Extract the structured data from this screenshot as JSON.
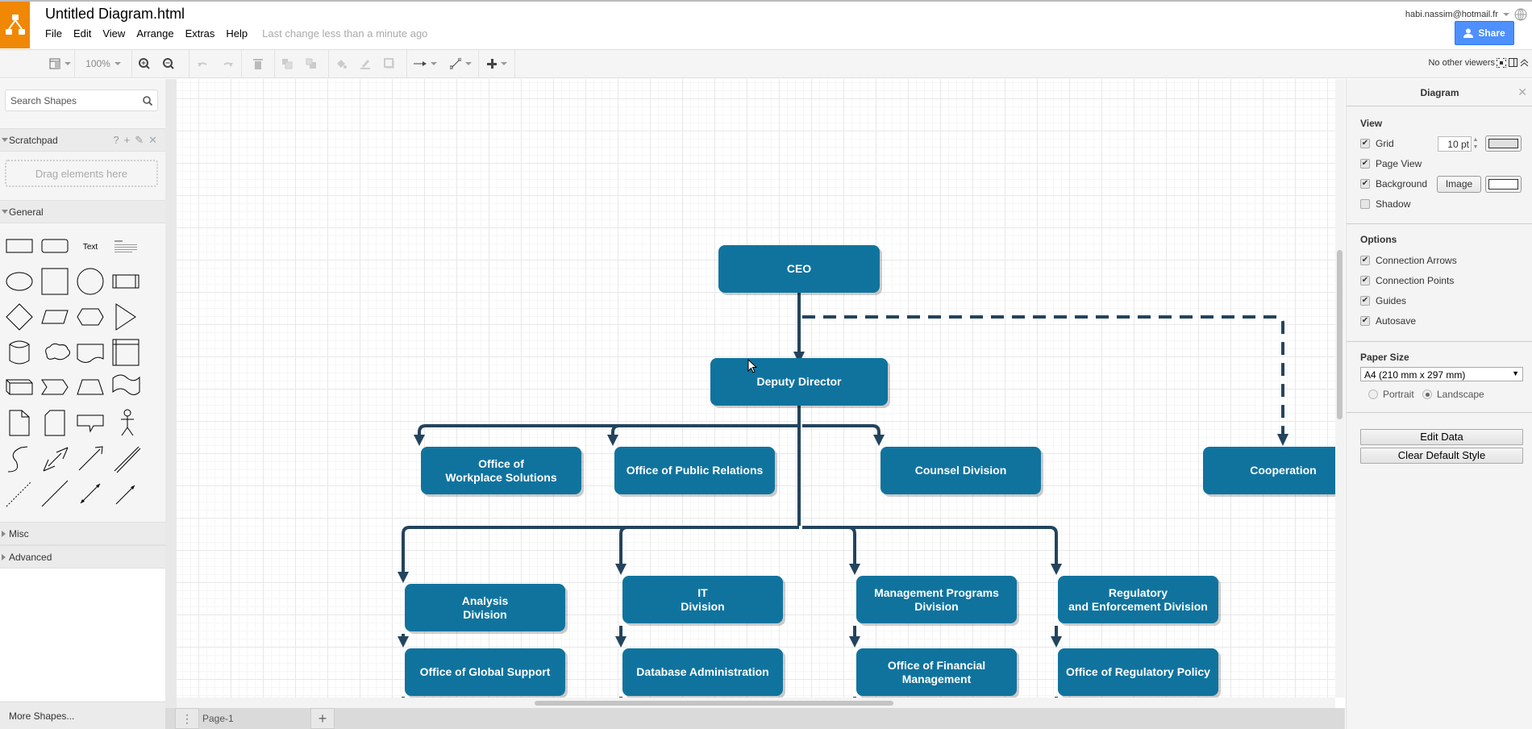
{
  "app": {
    "title": "Untitled Diagram.html",
    "menu": [
      "File",
      "Edit",
      "View",
      "Arrange",
      "Extras",
      "Help"
    ],
    "last_change": "Last change less than a minute ago",
    "user": "habi.nassim@hotmail.fr",
    "share_label": "Share",
    "viewers": "No other viewers"
  },
  "toolbar": {
    "zoom": "100%"
  },
  "sidebar": {
    "search_placeholder": "Search Shapes",
    "scratchpad": "Scratchpad",
    "scratchpad_actions": [
      "?",
      "+",
      "✎",
      "✕"
    ],
    "drop_hint": "Drag elements here",
    "general": "General",
    "text_shape": "Text",
    "misc": "Misc",
    "advanced": "Advanced",
    "more_shapes": "More Shapes..."
  },
  "pages": {
    "current": "Page-1"
  },
  "panel": {
    "title": "Diagram",
    "view_heading": "View",
    "grid": {
      "label": "Grid",
      "checked": true,
      "size": "10 pt",
      "color": "#e0e0e0"
    },
    "page_view": {
      "label": "Page View",
      "checked": true
    },
    "background": {
      "label": "Background",
      "checked": true,
      "image_button": "Image",
      "color": "#ffffff"
    },
    "shadow": {
      "label": "Shadow",
      "checked": false
    },
    "options_heading": "Options",
    "options": [
      {
        "label": "Connection Arrows",
        "checked": true
      },
      {
        "label": "Connection Points",
        "checked": true
      },
      {
        "label": "Guides",
        "checked": true
      },
      {
        "label": "Autosave",
        "checked": true
      }
    ],
    "paper_heading": "Paper Size",
    "paper_size": "A4 (210 mm x 297 mm)",
    "orientation": {
      "portrait": "Portrait",
      "landscape": "Landscape",
      "selected": "landscape"
    },
    "edit_data": "Edit Data",
    "clear_style": "Clear Default Style"
  },
  "diagram": {
    "node_color": "#10739e",
    "edge_color": "#23445d",
    "nodes": {
      "ceo": "CEO",
      "deputy": "Deputy Director",
      "workplace": "Office of\nWorkplace Solutions",
      "public_relations": "Office of Public Relations",
      "counsel": "Counsel Division",
      "cooperation": "Cooperation",
      "analysis": "Analysis\nDivision",
      "it": "IT\nDivision",
      "management": "Management Programs\nDivision",
      "regulatory": "Regulatory\nand Enforcement Division",
      "global_support": "Office of Global Support",
      "database": "Database Administration",
      "financial": "Office of Financial\nManagement",
      "reg_policy": "Office of Regulatory Policy"
    }
  }
}
